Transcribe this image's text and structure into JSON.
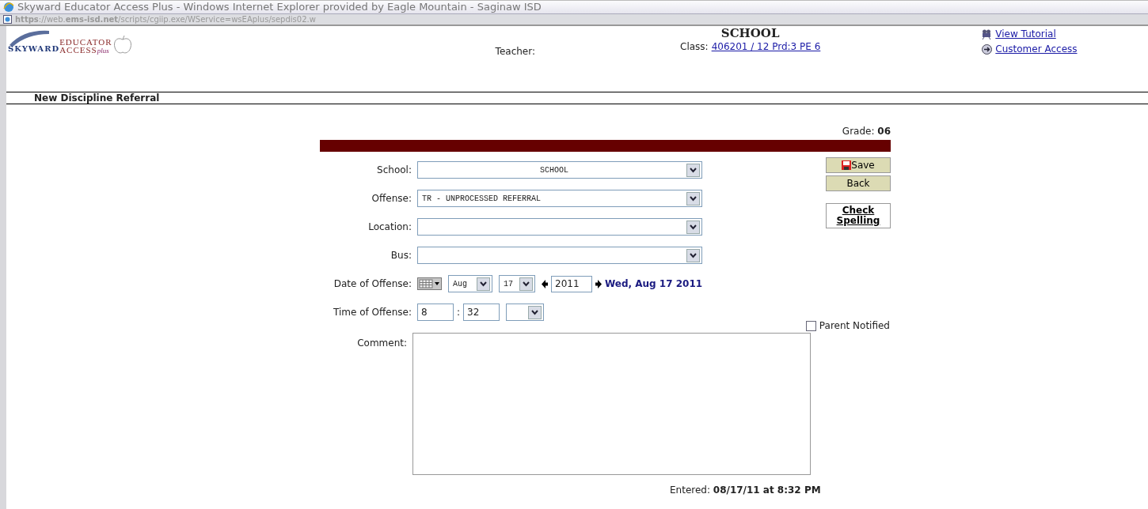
{
  "window": {
    "title": "Skyward Educator Access Plus - Windows Internet Explorer provided by Eagle Mountain - Saginaw ISD"
  },
  "address_bar": {
    "url": "**https**://web.**ems-isd.net**/scripts/cgiip.exe/WService=wsEAplus/sepdis02.w"
  },
  "header": {
    "logo": {
      "brand": "SKYWARD",
      "line1": "EDUCATOR",
      "line2": "ACCESS",
      "suffix": "plus"
    },
    "teacher_label": "Teacher:",
    "school": "SCHOOL",
    "class_label": "Class:",
    "class_link": "406201 / 12 Prd:3 PE 6",
    "links": [
      {
        "kind": "tutorial",
        "label": "View Tutorial"
      },
      {
        "kind": "access",
        "label": "Customer Access"
      }
    ]
  },
  "page_title": "New Discipline Referral",
  "grade": "Grade: **06**",
  "fields": [
    {
      "kind": "select",
      "label": "School:",
      "value": "SCHOOL",
      "centered": true
    },
    {
      "kind": "select",
      "label": "Offense:",
      "value": "TR  - UNPROCESSED REFERRAL",
      "centered": false
    },
    {
      "kind": "select",
      "label": "Location:"
    },
    {
      "kind": "select",
      "label": "Bus:"
    },
    {
      "kind": "date",
      "label": "Date of Offense:",
      "month": "Aug",
      "day": "17",
      "year": "2011",
      "display": "Wed, Aug 17 2011"
    },
    {
      "kind": "time",
      "label": "Time of Offense:",
      "hour": "8",
      "separator": ":",
      "minute": "32"
    }
  ],
  "parent_notified": {
    "label": "Parent Notified",
    "checked": false
  },
  "comment": {
    "label": "Comment:"
  },
  "buttons": [
    {
      "kind": "save",
      "label": "Save"
    },
    {
      "kind": "back",
      "label": "Back"
    },
    {
      "kind": "spell",
      "label": "Check Spelling"
    }
  ],
  "entered": "Entered: **08/17/11 at 8:32 PM**"
}
